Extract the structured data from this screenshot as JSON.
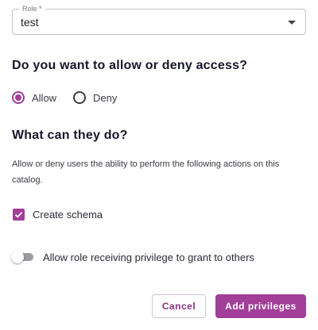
{
  "role_field": {
    "label": "Role *",
    "value": "test"
  },
  "access_section": {
    "heading": "Do you want to allow or deny access?",
    "options": [
      {
        "label": "Allow",
        "selected": true
      },
      {
        "label": "Deny",
        "selected": false
      }
    ]
  },
  "actions_section": {
    "heading": "What can they do?",
    "description": "Allow or deny users the ability to perform the following actions on this catalog.",
    "checkbox": {
      "label": "Create schema",
      "checked": true
    },
    "toggle": {
      "label": "Allow role receiving privilege to grant to others",
      "on": false
    }
  },
  "footer": {
    "cancel_label": "Cancel",
    "submit_label": "Add privileges"
  },
  "colors": {
    "accent": "#a23d98",
    "heading": "#16162a"
  }
}
